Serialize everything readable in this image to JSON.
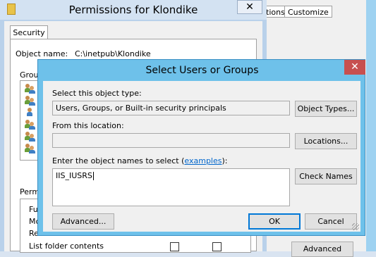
{
  "background_window": {
    "tabs": [
      "tions",
      "Customize"
    ],
    "advanced_button": "Advanced"
  },
  "permissions_window": {
    "title": "Permissions for Klondike",
    "close_glyph": "✕",
    "tab": "Security",
    "object_name_label": "Object name:",
    "object_name_value": "C:\\inetpub\\Klondike",
    "groups_label": "Group",
    "permissions_label": "Permi",
    "permission_rows": [
      "Ful",
      "Mc",
      "Re",
      "List folder contents"
    ]
  },
  "dialog": {
    "title": "Select Users or Groups",
    "close_glyph": "✕",
    "object_type_label": "Select this object type:",
    "object_type_value": "Users, Groups, or Built-in security principals",
    "object_types_button": "Object Types...",
    "location_label": "From this location:",
    "location_value": "",
    "locations_button": "Locations...",
    "names_label_prefix": "Enter the object names to select (",
    "names_label_link": "examples",
    "names_label_suffix": "):",
    "names_value": "IIS_IUSRS",
    "check_names_button": "Check Names",
    "advanced_button": "Advanced...",
    "ok_button": "OK",
    "cancel_button": "Cancel"
  }
}
